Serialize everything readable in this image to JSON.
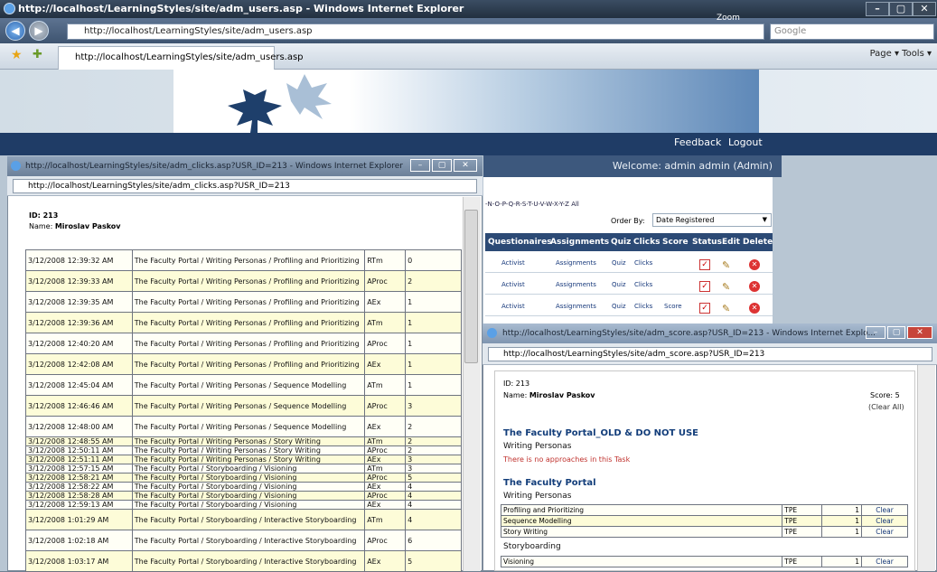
{
  "browser": {
    "title": "http://localhost/LearningStyles/site/adm_users.asp - Windows Internet Explorer",
    "address": "http://localhost/LearningStyles/site/adm_users.asp",
    "zoom_label": "Zoom",
    "search_placeholder": "Google",
    "tab_label": "http://localhost/LearningStyles/site/adm_users.asp",
    "tools_label": "Page ▾   Tools ▾"
  },
  "site": {
    "nav": {
      "feedback": "Feedback",
      "logout": "Logout"
    },
    "welcome": "Welcome: admin admin (Admin)",
    "alphabet": "-N-O-P-Q-R-S-T-U-V-W-X-Y-Z All",
    "order_by_label": "Order By:",
    "order_by_value": "Date Registered",
    "columns": [
      "Questionaires",
      "Assignments",
      "Quiz",
      "Clicks",
      "Score",
      "Status",
      "Edit",
      "Delete"
    ],
    "rows": [
      {
        "q": "Activist",
        "a": "Assignments",
        "quiz": "Quiz",
        "clicks": "Clicks",
        "score": ""
      },
      {
        "q": "Activist",
        "a": "Assignments",
        "quiz": "Quiz",
        "clicks": "Clicks",
        "score": ""
      },
      {
        "q": "Activist",
        "a": "Assignments",
        "quiz": "Quiz",
        "clicks": "Clicks",
        "score": "Score"
      }
    ]
  },
  "popup_clicks": {
    "title": "http://localhost/LearningStyles/site/adm_clicks.asp?USR_ID=213 - Windows Internet Explorer",
    "address": "http://localhost/LearningStyles/site/adm_clicks.asp?USR_ID=213",
    "id_label": "ID: 213",
    "name_label": "Name:",
    "name_value": "Miroslav Paskov",
    "rows": [
      [
        "3/12/2008 12:39:32 AM",
        "The Faculty Portal / Writing Personas / Profiling and Prioritizing",
        "RTm",
        "0"
      ],
      [
        "3/12/2008 12:39:33 AM",
        "The Faculty Portal / Writing Personas / Profiling and Prioritizing",
        "AProc",
        "2"
      ],
      [
        "3/12/2008 12:39:35 AM",
        "The Faculty Portal / Writing Personas / Profiling and Prioritizing",
        "AEx",
        "1"
      ],
      [
        "3/12/2008 12:39:36 AM",
        "The Faculty Portal / Writing Personas / Profiling and Prioritizing",
        "ATm",
        "1"
      ],
      [
        "3/12/2008 12:40:20 AM",
        "The Faculty Portal / Writing Personas / Profiling and Prioritizing",
        "AProc",
        "1"
      ],
      [
        "3/12/2008 12:42:08 AM",
        "The Faculty Portal / Writing Personas / Profiling and Prioritizing",
        "AEx",
        "1"
      ],
      [
        "3/12/2008 12:45:04 AM",
        "The Faculty Portal / Writing Personas / Sequence Modelling",
        "ATm",
        "1"
      ],
      [
        "3/12/2008 12:46:46 AM",
        "The Faculty Portal / Writing Personas / Sequence Modelling",
        "AProc",
        "3"
      ],
      [
        "3/12/2008 12:48:00 AM",
        "The Faculty Portal / Writing Personas / Sequence Modelling",
        "AEx",
        "2"
      ],
      [
        "3/12/2008 12:48:55 AM",
        "The Faculty Portal / Writing Personas / Story Writing",
        "ATm",
        "2"
      ],
      [
        "3/12/2008 12:50:11 AM",
        "The Faculty Portal / Writing Personas / Story Writing",
        "AProc",
        "2"
      ],
      [
        "3/12/2008 12:51:11 AM",
        "The Faculty Portal / Writing Personas / Story Writing",
        "AEx",
        "3"
      ],
      [
        "3/12/2008 12:57:15 AM",
        "The Faculty Portal / Storyboarding / Visioning",
        "ATm",
        "3"
      ],
      [
        "3/12/2008 12:58:21 AM",
        "The Faculty Portal / Storyboarding / Visioning",
        "AProc",
        "5"
      ],
      [
        "3/12/2008 12:58:22 AM",
        "The Faculty Portal / Storyboarding / Visioning",
        "AEx",
        "4"
      ],
      [
        "3/12/2008 12:58:28 AM",
        "The Faculty Portal / Storyboarding / Visioning",
        "AProc",
        "4"
      ],
      [
        "3/12/2008 12:59:13 AM",
        "The Faculty Portal / Storyboarding / Visioning",
        "AEx",
        "4"
      ],
      [
        "3/12/2008 1:01:29 AM",
        "The Faculty Portal / Storyboarding / Interactive Storyboarding",
        "ATm",
        "4"
      ],
      [
        "3/12/2008 1:02:18 AM",
        "The Faculty Portal / Storyboarding / Interactive Storyboarding",
        "AProc",
        "6"
      ],
      [
        "3/12/2008 1:03:17 AM",
        "The Faculty Portal / Storyboarding / Interactive Storyboarding",
        "AEx",
        "5"
      ]
    ]
  },
  "popup_score": {
    "title": "http://localhost/LearningStyles/site/adm_score.asp?USR_ID=213 - Windows Internet Explo...",
    "address": "http://localhost/LearningStyles/site/adm_score.asp?USR_ID=213",
    "id_label": "ID: 213",
    "name_label": "Name:",
    "name_value": "Miroslav Paskov",
    "score_label": "Score: 5",
    "clear_all": "(Clear All)",
    "section1_title": "The Faculty Portal_OLD & DO NOT USE",
    "section1_sub": "Writing Personas",
    "no_approaches": "There is no approaches in this Task",
    "section2_title": "The Faculty Portal",
    "section2_sub": "Writing Personas",
    "table1": [
      [
        "Profiling and Prioritizing",
        "TPE",
        "1",
        "Clear"
      ],
      [
        "Sequence Modelling",
        "TPE",
        "1",
        "Clear"
      ],
      [
        "Story Writing",
        "TPE",
        "1",
        "Clear"
      ]
    ],
    "section3_sub": "Storyboarding",
    "table2": [
      [
        "Visioning",
        "TPE",
        "1",
        "Clear"
      ]
    ]
  }
}
